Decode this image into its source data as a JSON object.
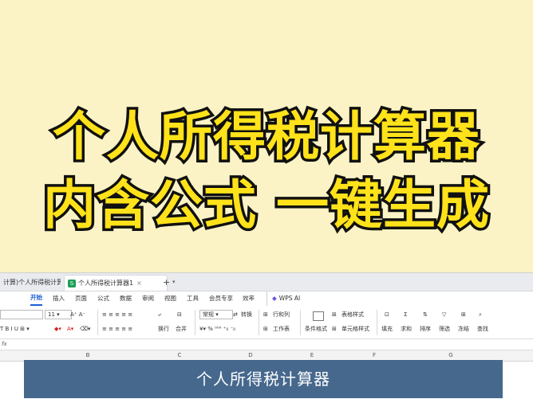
{
  "headline": {
    "line1": "个人所得税计算器",
    "line2": "内含公式 一键生成"
  },
  "tabs": [
    {
      "label": "计算)个人所得税计算器"
    },
    {
      "label": "个人所得税计算器1",
      "badge": "S"
    }
  ],
  "tab_actions": {
    "plus": "+",
    "chevron": "▾"
  },
  "menu": {
    "items": [
      "开始",
      "插入",
      "页面",
      "公式",
      "数据",
      "审阅",
      "视图",
      "工具",
      "会员专享",
      "效率"
    ],
    "active": "开始",
    "wps_ai": "WPS AI"
  },
  "ribbon": {
    "font_size": "11",
    "number_format": "常规",
    "convert": "转换",
    "row_col": "行和列",
    "worksheet": "工作表",
    "table_style": "表格样式",
    "cell_style": "单元格样式",
    "conditional_format": "条件格式",
    "wrap": "换行",
    "merge": "合并",
    "fill": "填充",
    "sum": "求和",
    "sort": "排序",
    "filter": "筛选",
    "freeze": "冻结",
    "find": "查找"
  },
  "formula_bar": {
    "fx": "fx"
  },
  "columns": [
    "B",
    "C",
    "D",
    "E",
    "F",
    "G"
  ],
  "bottom_band": {
    "text": "个人所得税计算器"
  }
}
